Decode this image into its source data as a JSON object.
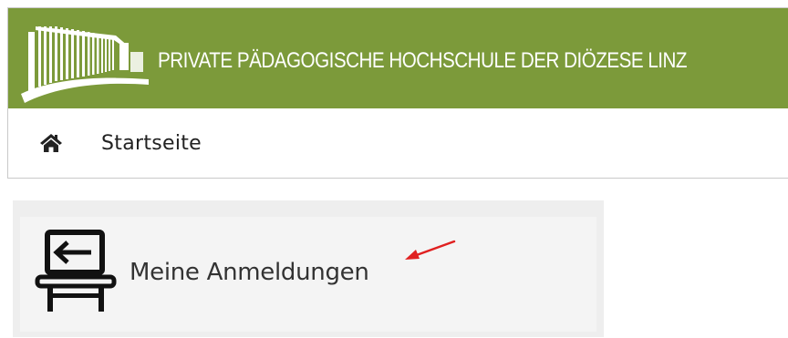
{
  "header": {
    "school_name": "PRIVATE PÄDAGOGISCHE HOCHSCHULE DER DIÖZESE LINZ",
    "banner_color": "#7c9a3a",
    "logo_icon": "building-columns-logo"
  },
  "nav": {
    "home_icon": "home-icon",
    "home_label": "Startseite"
  },
  "tiles": [
    {
      "icon": "lectern-arrow-left-icon",
      "label": "Meine Anmeldungen"
    }
  ],
  "annotation": {
    "type": "arrow",
    "color": "#e02020"
  }
}
